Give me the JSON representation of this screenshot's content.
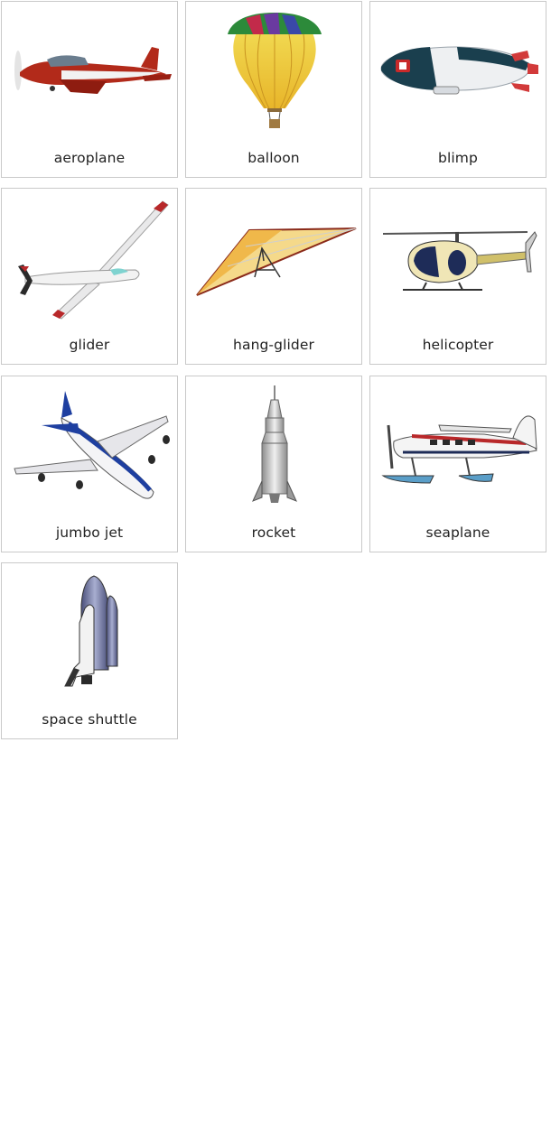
{
  "cards": [
    {
      "label": "aeroplane",
      "icon": "aeroplane-icon"
    },
    {
      "label": "balloon",
      "icon": "hot-air-balloon-icon"
    },
    {
      "label": "blimp",
      "icon": "blimp-icon"
    },
    {
      "label": "glider",
      "icon": "glider-icon"
    },
    {
      "label": "hang-glider",
      "icon": "hang-glider-icon"
    },
    {
      "label": "helicopter",
      "icon": "helicopter-icon"
    },
    {
      "label": "jumbo jet",
      "icon": "jumbo-jet-icon"
    },
    {
      "label": "rocket",
      "icon": "rocket-icon"
    },
    {
      "label": "seaplane",
      "icon": "seaplane-icon"
    },
    {
      "label": "space shuttle",
      "icon": "space-shuttle-icon"
    }
  ],
  "colors": {
    "card_border": "#c9c9c9",
    "label_text": "#222222"
  }
}
